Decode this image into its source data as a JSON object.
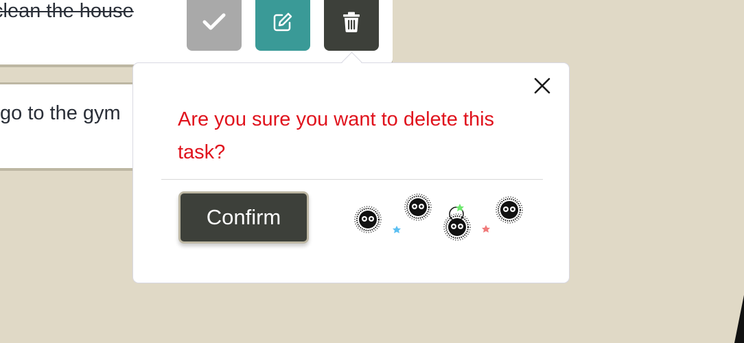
{
  "tasks": [
    {
      "text": "clean the house",
      "completed": true
    },
    {
      "text": "go to the gym",
      "completed": false
    }
  ],
  "actions": {
    "complete_icon": "check-icon",
    "edit_icon": "edit-icon",
    "delete_icon": "trash-icon"
  },
  "popover": {
    "message": "Are you sure you want to delete this task?",
    "confirm_label": "Confirm",
    "close_icon": "close-icon"
  },
  "colors": {
    "background": "#e0d9c6",
    "complete_button": "#a9a9a9",
    "edit_button": "#3a9a97",
    "delete_button": "#3d403a",
    "warning_text": "#e0131d",
    "card_border": "#bdb7a3"
  }
}
